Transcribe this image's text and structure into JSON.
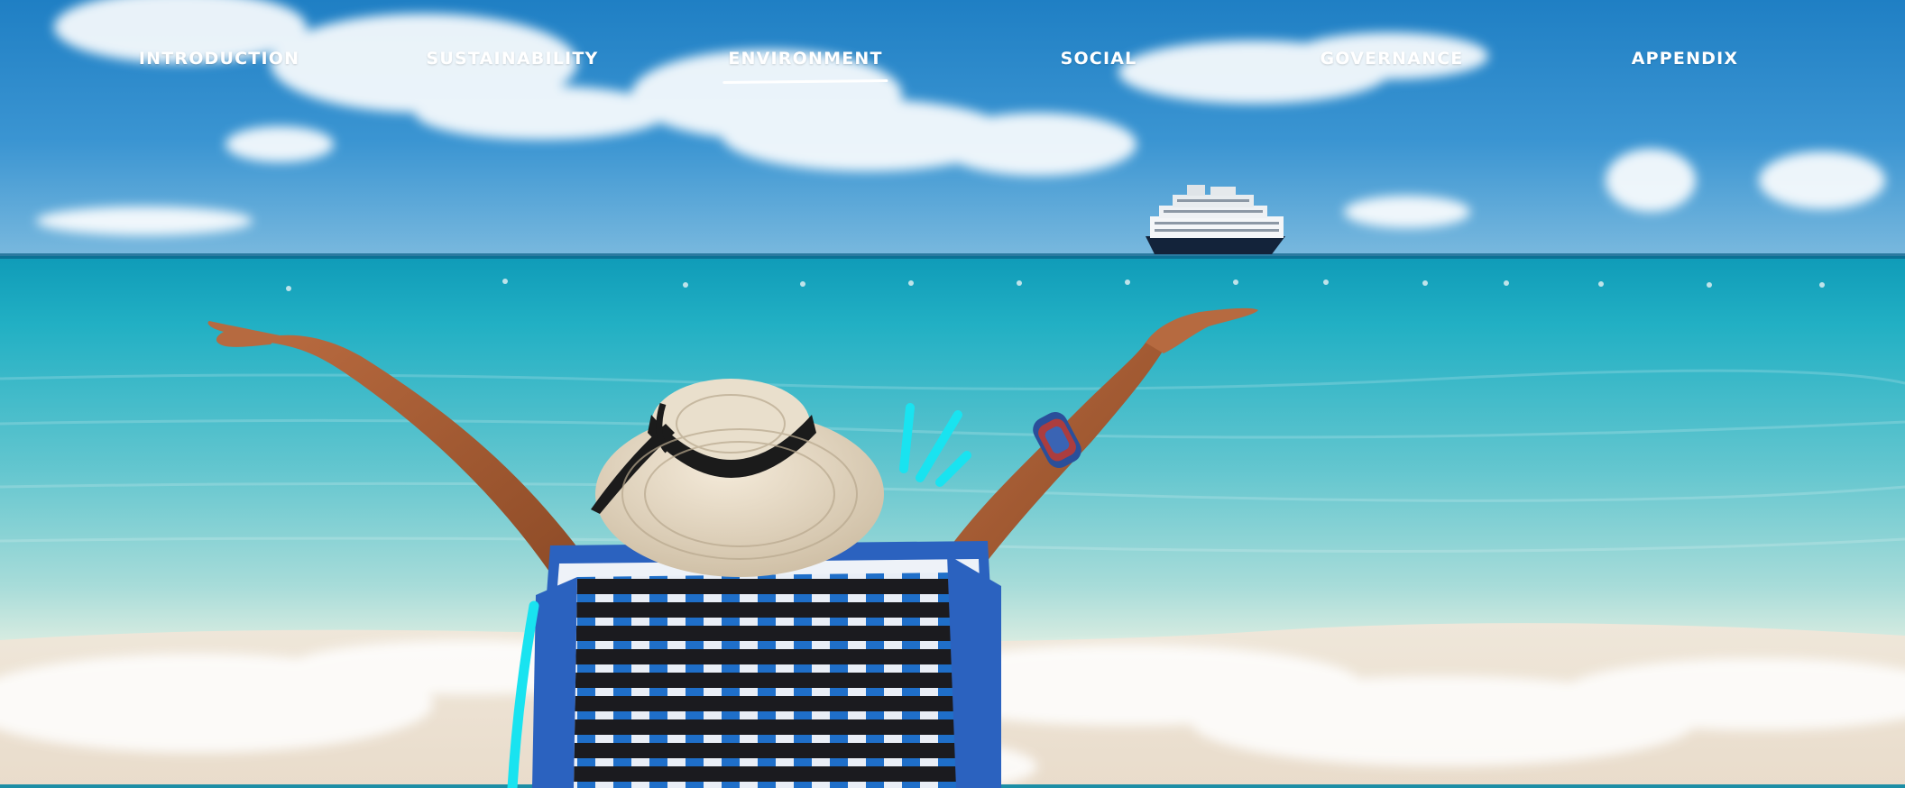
{
  "nav": {
    "items": [
      {
        "label": "INTRODUCTION"
      },
      {
        "label": "SUSTAINABILITY"
      },
      {
        "label": "ENVIRONMENT",
        "active": true
      },
      {
        "label": "SOCIAL"
      },
      {
        "label": "GOVERNANCE"
      },
      {
        "label": "APPENDIX"
      }
    ]
  },
  "colors": {
    "sky_top": "#1f7fc4",
    "sky_bottom": "#6fb6df",
    "sea_deep": "#1aa6bd",
    "sea_shallow": "#8fd7dc",
    "sand": "#f1e4d3",
    "accent_cyan": "#19e3f0",
    "nav_text": "#ffffff"
  },
  "icons": [
    "cyan-brush-strokes",
    "cruise-ship"
  ]
}
